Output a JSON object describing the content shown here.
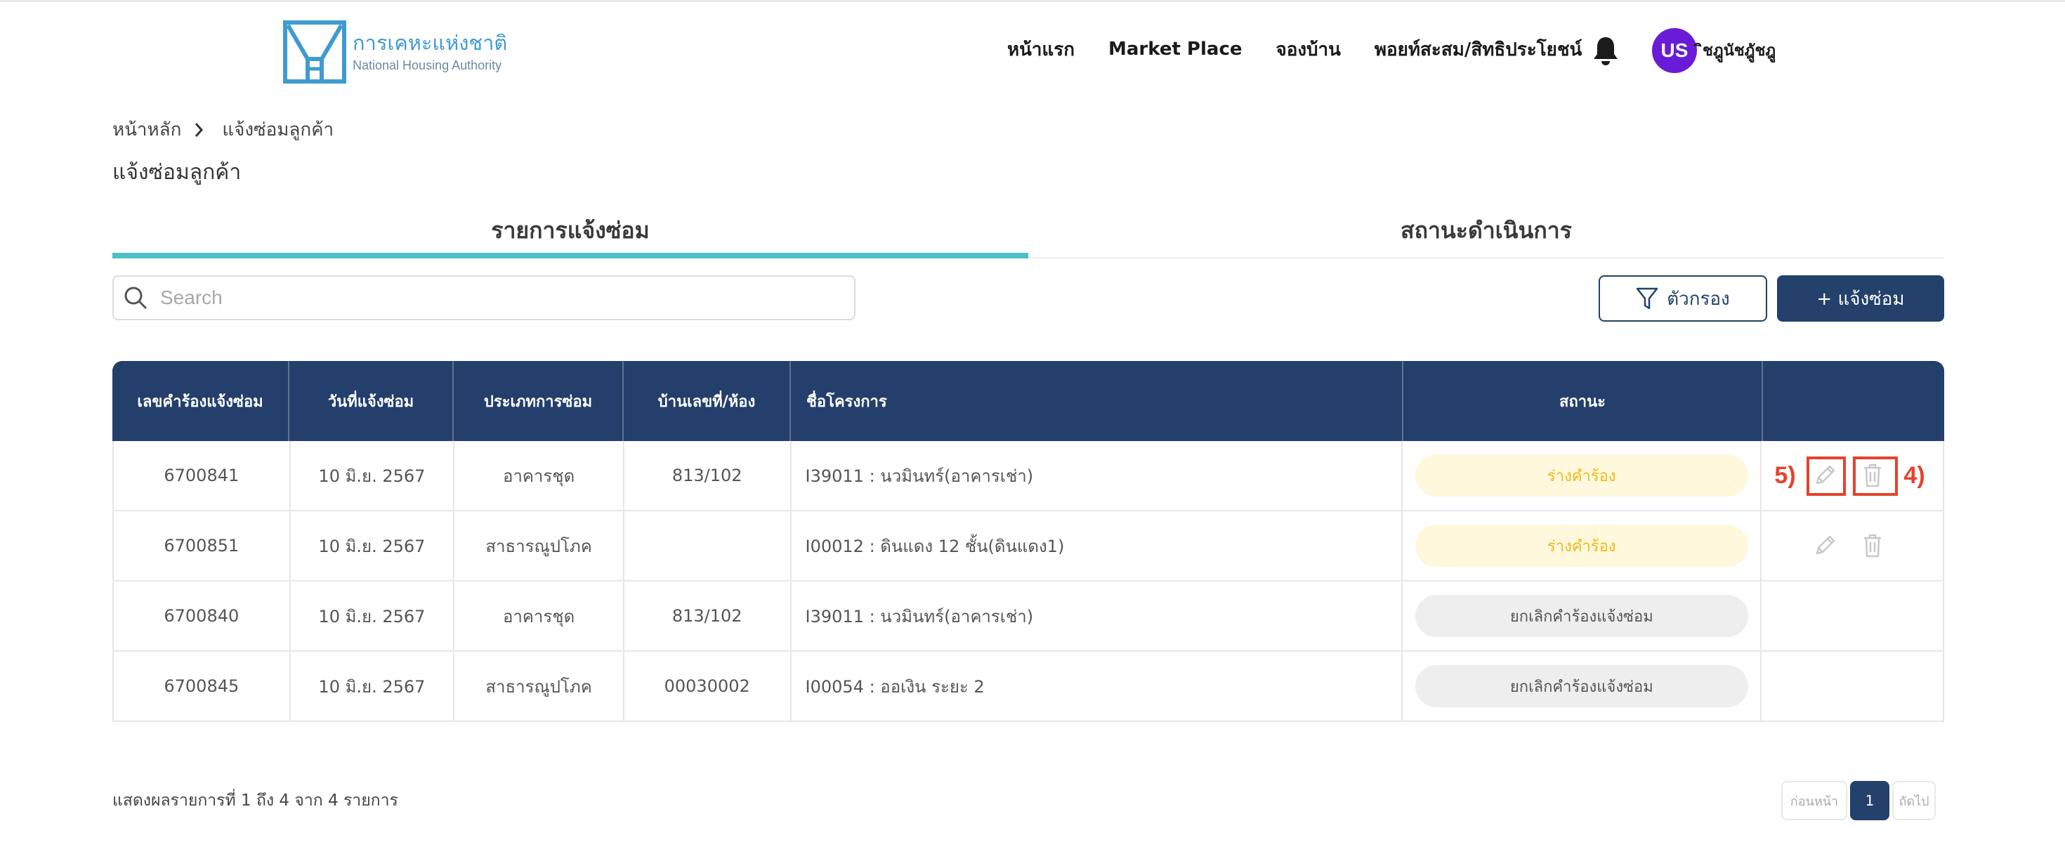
{
  "brand": {
    "name_th": "การเคหะแห่งชาติ",
    "name_en": "National Housing Authority",
    "color": "#3f9bd1"
  },
  "nav": {
    "items": [
      "หน้าแรก",
      "Market Place",
      "จองบ้าน",
      "พอยท์สะสม/สิทธิประโยชน์"
    ]
  },
  "user": {
    "initials": "US",
    "name": "ิชฎูนัชฎูัชฎู",
    "avatar_color": "#6a1bd8"
  },
  "breadcrumb": {
    "home": "หน้าหลัก",
    "current": "แจ้งซ่อมลูกค้า"
  },
  "page": {
    "title": "แจ้งซ่อมลูกค้า"
  },
  "tabs": [
    {
      "label": "รายการแจ้งซ่อม",
      "active": true
    },
    {
      "label": "สถานะดำเนินการ",
      "active": false
    }
  ],
  "search": {
    "placeholder": "Search",
    "value": ""
  },
  "toolbar": {
    "filter_label": "ตัวกรอง",
    "add_label": "+ แจ้งซ่อม"
  },
  "table": {
    "headers": [
      "เลขคำร้องแจ้งซ่อม",
      "วันที่แจ้งซ่อม",
      "ประเภทการซ่อม",
      "บ้านเลขที่/ห้อง",
      "ชื่อโครงการ",
      "สถานะ",
      ""
    ],
    "rows": [
      {
        "id": "6700841",
        "date": "10 มิ.ย. 2567",
        "type": "อาคารชุด",
        "unit": "813/102",
        "project": "I39011 : นวมินทร์(อาคารเช่า)",
        "status": "ร่างคำร้อง",
        "status_kind": "draft",
        "actions": true
      },
      {
        "id": "6700851",
        "date": "10 มิ.ย. 2567",
        "type": "สาธารณูปโภค",
        "unit": "",
        "project": "I00012 : ดินแดง 12 ชั้น(ดินแดง1)",
        "status": "ร่างคำร้อง",
        "status_kind": "draft",
        "actions": true
      },
      {
        "id": "6700840",
        "date": "10 มิ.ย. 2567",
        "type": "อาคารชุด",
        "unit": "813/102",
        "project": "I39011 : นวมินทร์(อาคารเช่า)",
        "status": "ยกเลิกคำร้องแจ้งซ่อม",
        "status_kind": "cancel",
        "actions": false
      },
      {
        "id": "6700845",
        "date": "10 มิ.ย. 2567",
        "type": "สาธารณูปโภค",
        "unit": "00030002",
        "project": "I00054 : ออเงิน ระยะ 2",
        "status": "ยกเลิกคำร้องแจ้งซ่อม",
        "status_kind": "cancel",
        "actions": false
      }
    ]
  },
  "annotations": {
    "edit_label": "5)",
    "delete_label": "4)",
    "color": "#e5432c"
  },
  "footer": {
    "summary": "แสดงผลรายการที่ 1 ถึง 4 จาก 4 รายการ",
    "prev": "ก่อนหน้า",
    "current_page": "1",
    "next": "ถัดไป"
  },
  "colors": {
    "primary": "#23416b",
    "accent": "#4cc0c4",
    "draft_bg": "#fff8dc",
    "draft_text": "#f0b81c",
    "cancel_bg": "#eeeeee"
  }
}
